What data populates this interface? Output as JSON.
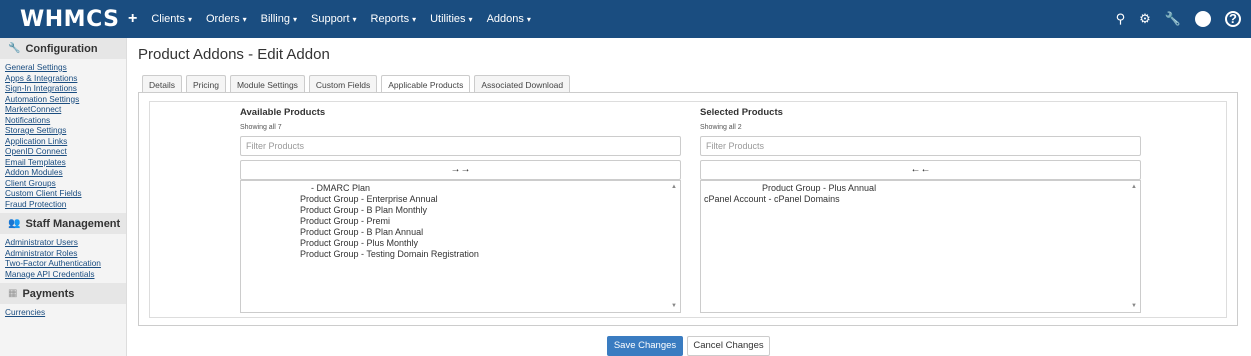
{
  "topbar": {
    "logo": "WHMCS",
    "plus": "+",
    "nav": [
      {
        "label": "Clients"
      },
      {
        "label": "Orders"
      },
      {
        "label": "Billing"
      },
      {
        "label": "Support"
      },
      {
        "label": "Reports"
      },
      {
        "label": "Utilities"
      },
      {
        "label": "Addons"
      }
    ],
    "right_icons": [
      "search-icon",
      "gear-icon",
      "wrench-icon",
      "user-avatar-icon",
      "help-icon"
    ]
  },
  "sidebar": {
    "sections": [
      {
        "title": "Configuration",
        "icon": "wrench-icon",
        "links": [
          "General Settings",
          "Apps & Integrations",
          "Sign-In Integrations",
          "Automation Settings",
          "MarketConnect",
          "Notifications",
          "Storage Settings",
          "Application Links",
          "OpenID Connect",
          "Email Templates",
          "Addon Modules",
          "Client Groups",
          "Custom Client Fields",
          "Fraud Protection"
        ]
      },
      {
        "title": "Staff Management",
        "icon": "users-icon",
        "links": [
          "Administrator Users",
          "Administrator Roles",
          "Two-Factor Authentication",
          "Manage API Credentials"
        ]
      },
      {
        "title": "Payments",
        "icon": "money-icon",
        "links": [
          "Currencies"
        ]
      }
    ]
  },
  "main": {
    "title": "Product Addons - Edit Addon",
    "tabs": [
      "Details",
      "Pricing",
      "Module Settings",
      "Custom Fields",
      "Applicable Products",
      "Associated Download"
    ],
    "active_tab": "Applicable Products",
    "available": {
      "title": "Available Products",
      "showing": "Showing all 7",
      "filter_placeholder": "Filter Products",
      "move_label": "→→",
      "items": [
        "- DMARC Plan",
        "Product Group - Enterprise Annual",
        "Product Group - B Plan Monthly",
        "Product Group - Premi",
        "Product Group - B Plan Annual",
        "Product Group - Plus Monthly",
        "Product Group - Testing Domain Registration"
      ]
    },
    "selected": {
      "title": "Selected Products",
      "showing": "Showing all 2",
      "filter_placeholder": "Filter Products",
      "move_label": "←←",
      "items": [
        "Product Group - Plus Annual",
        "cPanel Account - cPanel Domains"
      ]
    }
  },
  "footer": {
    "save": "Save Changes",
    "cancel": "Cancel Changes"
  }
}
